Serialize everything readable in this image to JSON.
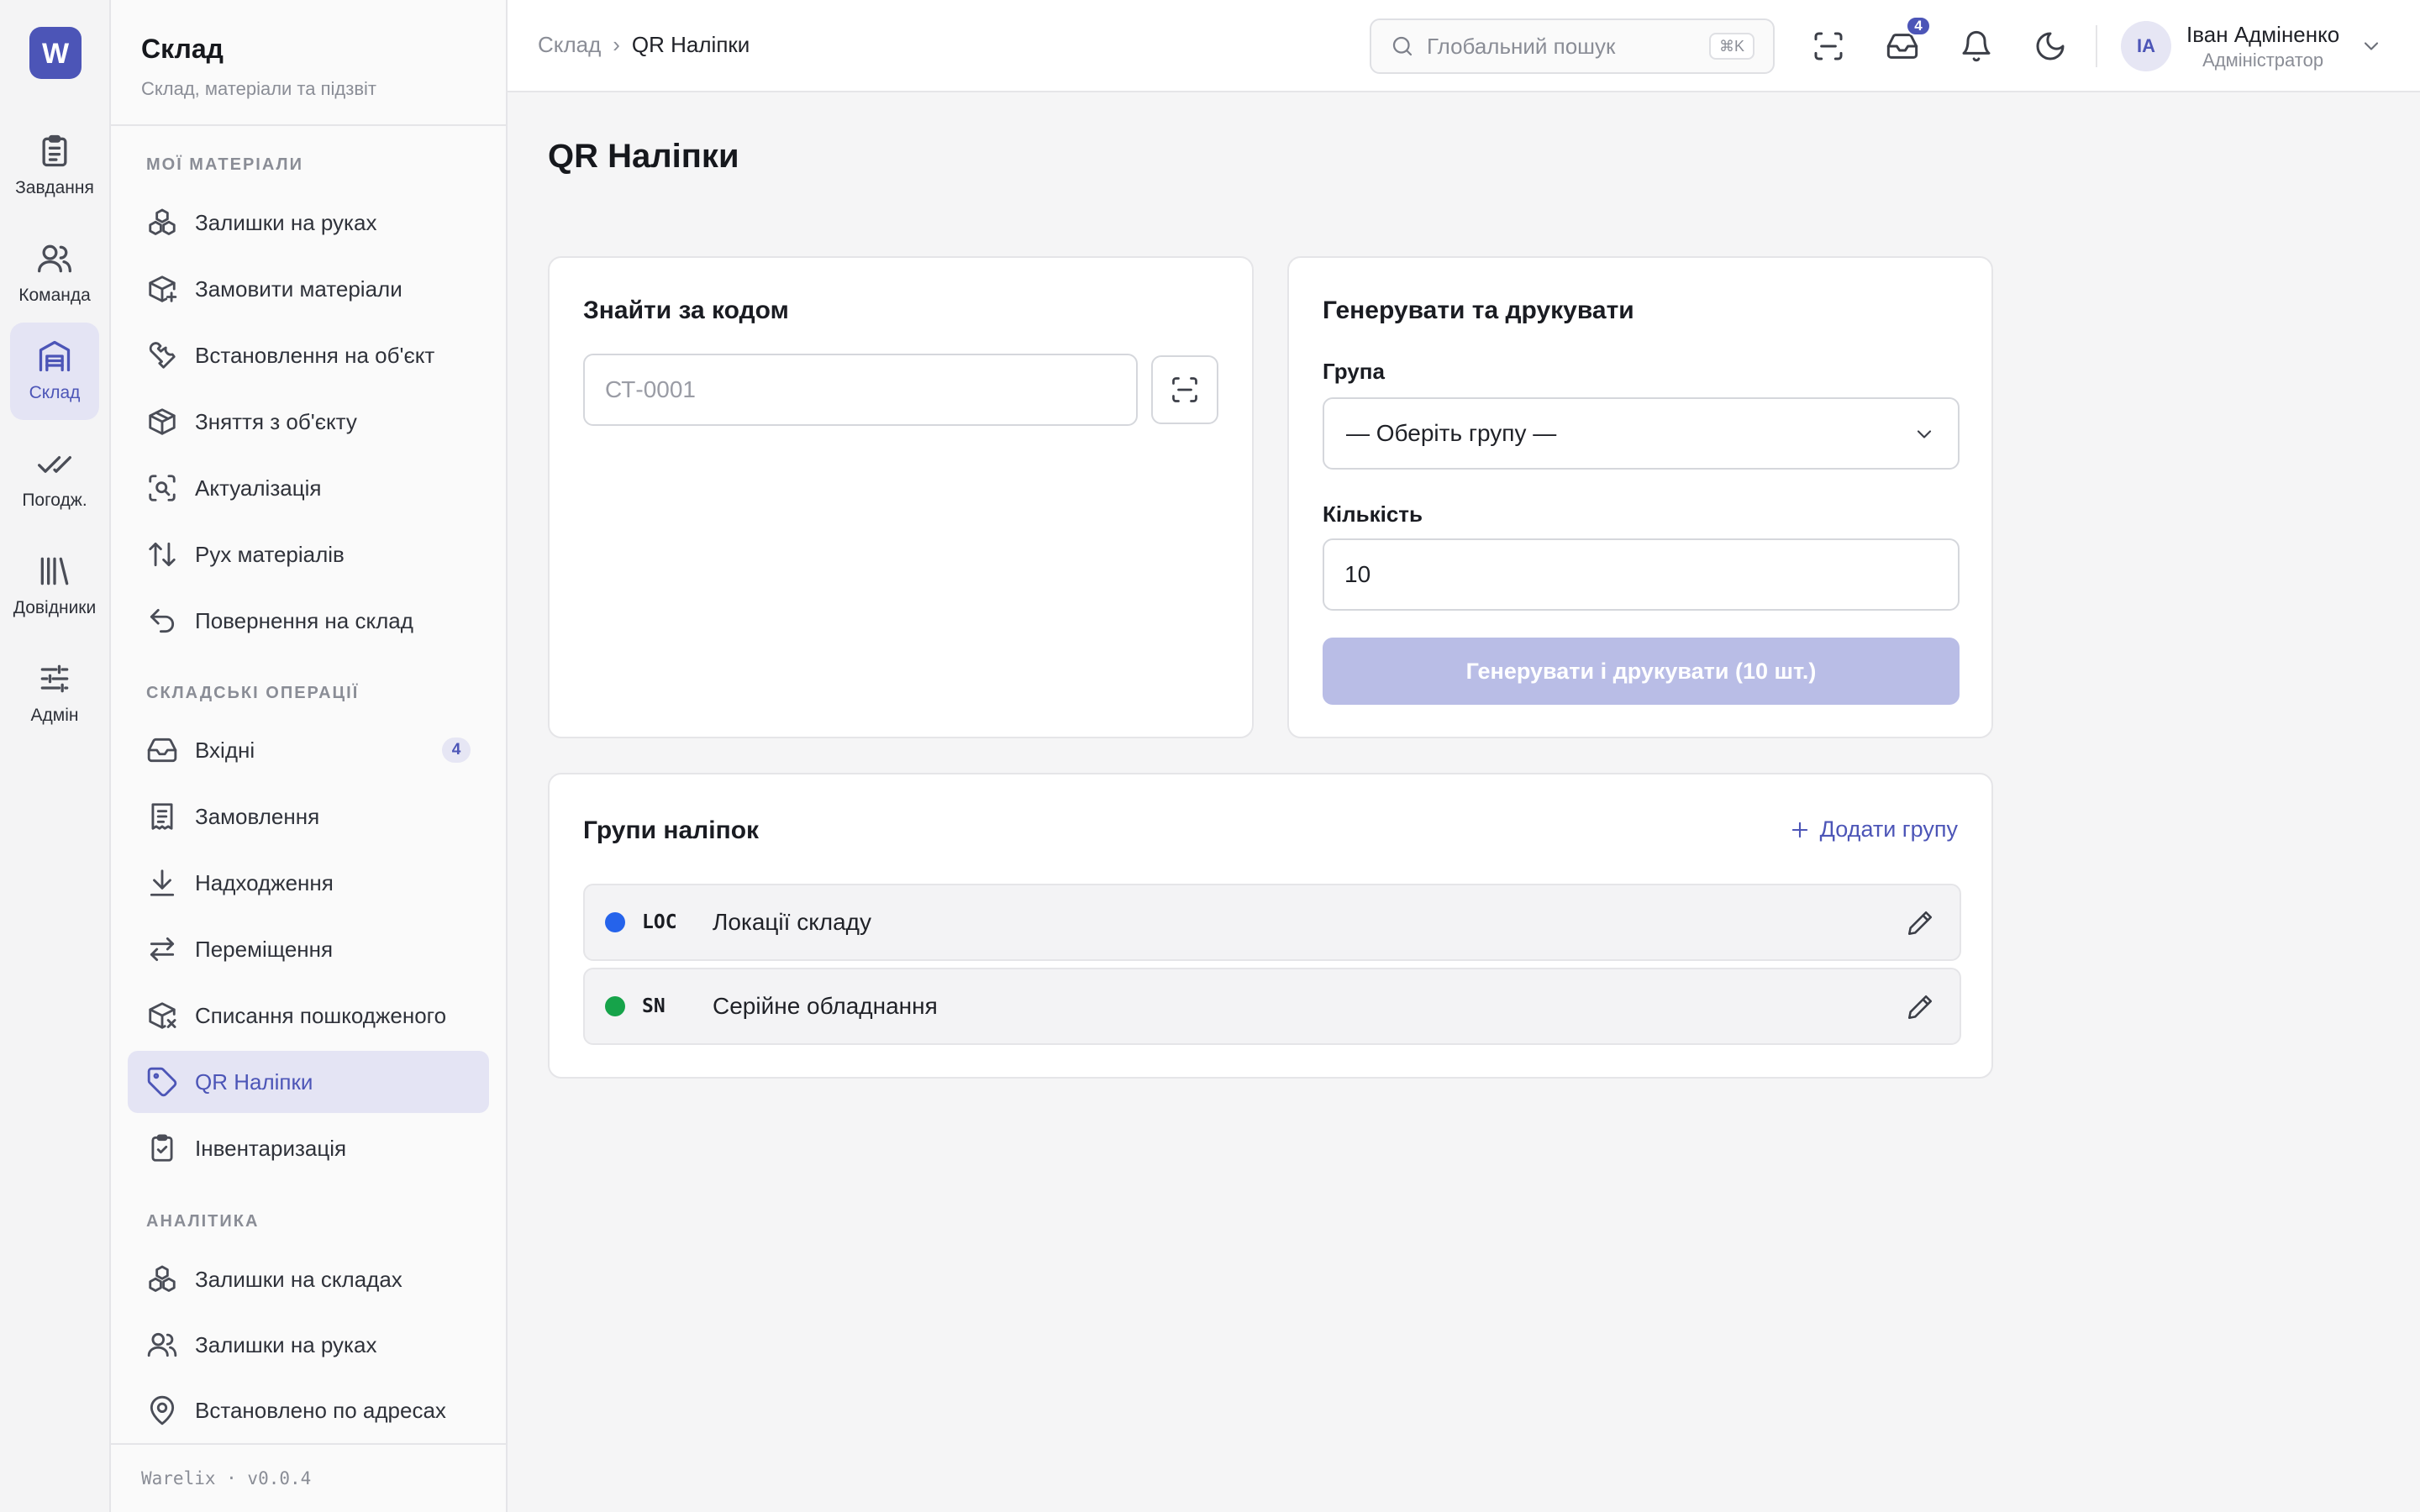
{
  "rail": {
    "logo_letter": "W",
    "items": [
      {
        "label": "Завдання",
        "icon": "clipboard-icon"
      },
      {
        "label": "Команда",
        "icon": "users-icon"
      },
      {
        "label": "Склад",
        "icon": "warehouse-icon",
        "active": true
      },
      {
        "label": "Погодж.",
        "icon": "double-check-icon"
      },
      {
        "label": "Довідники",
        "icon": "library-icon"
      },
      {
        "label": "Адмін",
        "icon": "sliders-icon"
      }
    ]
  },
  "sidebar": {
    "title": "Склад",
    "subtitle": "Склад, матеріали та підзвіт",
    "sections": [
      {
        "title": "МОЇ МАТЕРІАЛИ",
        "items": [
          {
            "label": "Залишки на руках",
            "icon": "boxes-icon"
          },
          {
            "label": "Замовити матеріали",
            "icon": "package-plus-icon"
          },
          {
            "label": "Встановлення на об'єкт",
            "icon": "wrench-icon"
          },
          {
            "label": "Зняття з об'єкту",
            "icon": "package-icon"
          },
          {
            "label": "Актуалізація",
            "icon": "scan-search-icon"
          },
          {
            "label": "Рух матеріалів",
            "icon": "arrows-up-down-icon"
          },
          {
            "label": "Повернення на склад",
            "icon": "undo-icon"
          }
        ]
      },
      {
        "title": "СКЛАДСЬКІ ОПЕРАЦІЇ",
        "items": [
          {
            "label": "Вхідні",
            "icon": "inbox-icon",
            "badge": "4"
          },
          {
            "label": "Замовлення",
            "icon": "receipt-icon"
          },
          {
            "label": "Надходження",
            "icon": "download-icon"
          },
          {
            "label": "Переміщення",
            "icon": "transfer-icon"
          },
          {
            "label": "Списання пошкодженого",
            "icon": "package-x-icon"
          },
          {
            "label": "QR Наліпки",
            "icon": "tag-icon",
            "active": true
          },
          {
            "label": "Інвентаризація",
            "icon": "clipboard-check-icon"
          }
        ]
      },
      {
        "title": "АНАЛІТИКА",
        "items": [
          {
            "label": "Залишки на складах",
            "icon": "boxes-icon"
          },
          {
            "label": "Залишки на руках",
            "icon": "users-icon"
          },
          {
            "label": "Встановлено по адресах",
            "icon": "map-pin-icon"
          }
        ]
      }
    ],
    "footer": "Warelix · v0.0.4"
  },
  "topbar": {
    "breadcrumb": {
      "root": "Склад",
      "separator": "›",
      "current": "QR Наліпки"
    },
    "search": {
      "placeholder": "Глобальний пошук",
      "shortcut": "⌘K"
    },
    "inbox_count": "4",
    "user": {
      "initials": "ІА",
      "name": "Іван Адміненко",
      "role": "Адміністратор"
    }
  },
  "page": {
    "title": "QR Наліпки",
    "find_card": {
      "title": "Знайти за кодом",
      "code_placeholder": "СТ-0001",
      "code_value": ""
    },
    "generate_card": {
      "title": "Генерувати та друкувати",
      "group_label": "Група",
      "group_value": "— Оберіть групу —",
      "quantity_label": "Кількість",
      "quantity_value": "10",
      "button_label": "Генерувати і друкувати (10 шт.)"
    },
    "groups_card": {
      "title": "Групи наліпок",
      "add_label": "Додати групу",
      "groups": [
        {
          "code": "LOC",
          "name": "Локації складу",
          "color": "#2563eb"
        },
        {
          "code": "SN",
          "name": "Серійне обладнання",
          "color": "#16a34a"
        }
      ]
    }
  },
  "colors": {
    "accent": "#4c55b7",
    "accent_light": "#e4e4f4",
    "button_disabled": "#b9bde6"
  }
}
